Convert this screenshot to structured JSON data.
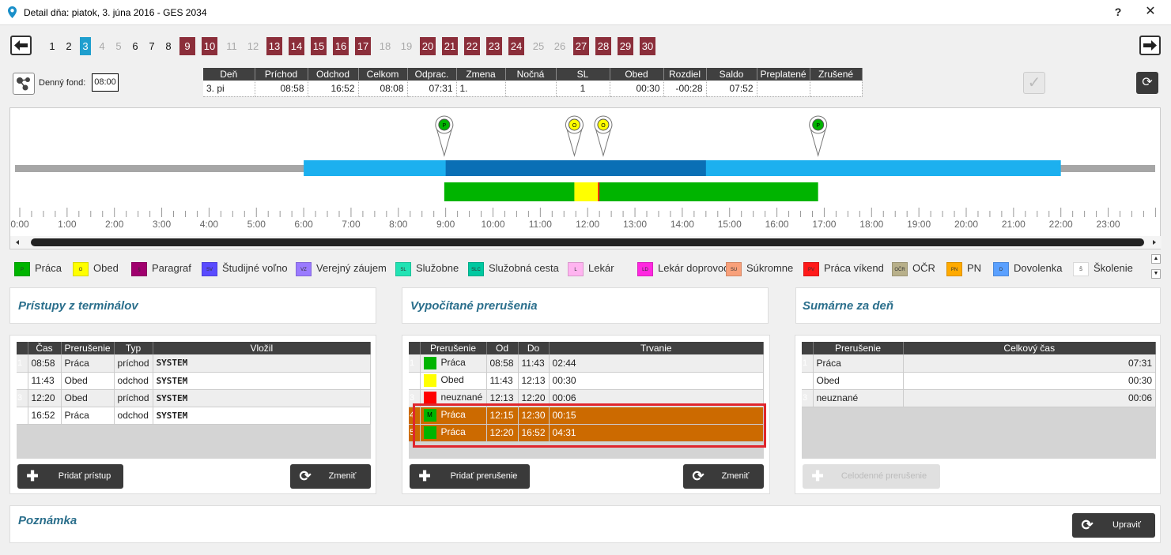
{
  "window": {
    "title": "Detail dňa: piatok, 3. júna 2016 - GES 2034",
    "help": "?",
    "close": "✕"
  },
  "days": [
    {
      "label": "1",
      "kind": "normal"
    },
    {
      "label": "2",
      "kind": "normal"
    },
    {
      "label": "3",
      "kind": "selected"
    },
    {
      "label": "4",
      "kind": "grey"
    },
    {
      "label": "5",
      "kind": "grey"
    },
    {
      "label": "6",
      "kind": "normal"
    },
    {
      "label": "7",
      "kind": "normal"
    },
    {
      "label": "8",
      "kind": "normal"
    },
    {
      "label": "9",
      "kind": "red"
    },
    {
      "label": "10",
      "kind": "red"
    },
    {
      "label": "11",
      "kind": "grey"
    },
    {
      "label": "12",
      "kind": "grey"
    },
    {
      "label": "13",
      "kind": "red"
    },
    {
      "label": "14",
      "kind": "red"
    },
    {
      "label": "15",
      "kind": "red"
    },
    {
      "label": "16",
      "kind": "red"
    },
    {
      "label": "17",
      "kind": "red"
    },
    {
      "label": "18",
      "kind": "grey"
    },
    {
      "label": "19",
      "kind": "grey"
    },
    {
      "label": "20",
      "kind": "red"
    },
    {
      "label": "21",
      "kind": "red"
    },
    {
      "label": "22",
      "kind": "red"
    },
    {
      "label": "23",
      "kind": "red"
    },
    {
      "label": "24",
      "kind": "red"
    },
    {
      "label": "25",
      "kind": "grey"
    },
    {
      "label": "26",
      "kind": "grey"
    },
    {
      "label": "27",
      "kind": "red"
    },
    {
      "label": "28",
      "kind": "red"
    },
    {
      "label": "29",
      "kind": "red"
    },
    {
      "label": "30",
      "kind": "red"
    }
  ],
  "colors": {
    "red_day": "#8b2e3a",
    "selected_day": "#1f9fce",
    "prace": "#00b400",
    "obed": "#ffff00",
    "orange": "#cc6a00",
    "shift_light": "#1cb0ef",
    "shift_dark": "#0a6fb5"
  },
  "fond": {
    "label": "Denný fond:",
    "value": "08:00"
  },
  "day_summary": {
    "headers": [
      "Deň",
      "Príchod",
      "Odchod",
      "Celkom",
      "Odprac.",
      "Zmena",
      "Nočná",
      "SL",
      "Obed",
      "Rozdiel",
      "Saldo",
      "Preplatené",
      "Zrušené"
    ],
    "row": [
      "3. pi",
      "08:58",
      "16:52",
      "08:08",
      "07:31",
      "1.",
      "",
      "1",
      "00:30",
      "-00:28",
      "07:52",
      "",
      ""
    ]
  },
  "timeline": {
    "hour_labels": [
      "0:00",
      "1:00",
      "2:00",
      "3:00",
      "4:00",
      "5:00",
      "6:00",
      "7:00",
      "8:00",
      "9:00",
      "10:00",
      "11:00",
      "12:00",
      "13:00",
      "14:00",
      "15:00",
      "16:00",
      "17:00",
      "18:00",
      "19:00",
      "20:00",
      "21:00",
      "22:00",
      "23:00"
    ],
    "markers": [
      {
        "letter": "P",
        "color": "#00b400",
        "time": 8.97
      },
      {
        "letter": "O",
        "color": "#ffff00",
        "time": 11.72
      },
      {
        "letter": "O",
        "color": "#ffff00",
        "time": 12.33
      },
      {
        "letter": "P",
        "color": "#00b400",
        "time": 16.87
      }
    ],
    "shift_light": {
      "from": 6.0,
      "to": 22.0
    },
    "shift_dark": {
      "from": 9.0,
      "to": 14.5
    },
    "segments": [
      {
        "from": 8.97,
        "to": 11.72,
        "color": "#00b400"
      },
      {
        "from": 11.72,
        "to": 12.22,
        "color": "#ffff00"
      },
      {
        "from": 12.22,
        "to": 12.25,
        "color": "#ff0000"
      },
      {
        "from": 12.25,
        "to": 16.87,
        "color": "#00b400"
      }
    ]
  },
  "legend": [
    {
      "code": "P",
      "label": "Práca",
      "color": "#00b400"
    },
    {
      "code": "O",
      "label": "Obed",
      "color": "#ffff00"
    },
    {
      "code": "§",
      "label": "Paragraf",
      "color": "#a0006e"
    },
    {
      "code": "SV",
      "label": "Študijné voľno",
      "color": "#5a4bff"
    },
    {
      "code": "VZ",
      "label": "Verejný záujem",
      "color": "#9a7aff"
    },
    {
      "code": "SL",
      "label": "Služobne",
      "color": "#22e3b4"
    },
    {
      "code": "SLC",
      "label": "Služobná cesta",
      "color": "#00c8a0"
    },
    {
      "code": "L",
      "label": "Lekár",
      "color": "#ffb4f0"
    },
    {
      "code": "LD",
      "label": "Lekár doprovod",
      "color": "#ff28e0"
    },
    {
      "code": "SU",
      "label": "Súkromne",
      "color": "#f8a07a"
    },
    {
      "code": "PV",
      "label": "Práca víkend",
      "color": "#ff1a1a"
    },
    {
      "code": "OČR",
      "label": "OČR",
      "color": "#b8b08a"
    },
    {
      "code": "PN",
      "label": "PN",
      "color": "#ffaa00"
    },
    {
      "code": "D",
      "label": "Dovolenka",
      "color": "#5aa0ff"
    },
    {
      "code": "Š",
      "label": "Školenie",
      "color": "#ffffff"
    }
  ],
  "panels": {
    "terminals": {
      "title": "Prístupy z terminálov",
      "headers": [
        "Čas",
        "Prerušenie",
        "Typ",
        "Vložil"
      ],
      "rows": [
        {
          "n": "1",
          "cas": "08:58",
          "prer": "Práca",
          "typ": "príchod",
          "vlozil": "SYSTEM"
        },
        {
          "n": "2",
          "cas": "11:43",
          "prer": "Obed",
          "typ": "odchod",
          "vlozil": "SYSTEM"
        },
        {
          "n": "3",
          "cas": "12:20",
          "prer": "Obed",
          "typ": "príchod",
          "vlozil": "SYSTEM"
        },
        {
          "n": "4",
          "cas": "16:52",
          "prer": "Práca",
          "typ": "odchod",
          "vlozil": "SYSTEM"
        }
      ],
      "add_label": "Pridať prístup",
      "change_label": "Zmeniť"
    },
    "computed": {
      "title": "Vypočítané prerušenia",
      "headers": [
        "Prerušenie",
        "Od",
        "Do",
        "Trvanie"
      ],
      "rows": [
        {
          "n": "1",
          "code": "",
          "color": "#00b400",
          "prer": "Práca",
          "od": "08:58",
          "do": "11:43",
          "trv": "02:44",
          "style": "alt"
        },
        {
          "n": "2",
          "code": "",
          "color": "#ffff00",
          "prer": "Obed",
          "od": "11:43",
          "do": "12:13",
          "trv": "00:30",
          "style": "wh"
        },
        {
          "n": "3",
          "code": "",
          "color": "#ff0000",
          "prer": "neuznané",
          "od": "12:13",
          "do": "12:20",
          "trv": "00:06",
          "style": "alt"
        },
        {
          "n": "4",
          "code": "M",
          "color": "#00b400",
          "prer": "Práca",
          "od": "12:15",
          "do": "12:30",
          "trv": "00:15",
          "style": "orange"
        },
        {
          "n": "5",
          "code": "",
          "color": "#00b400",
          "prer": "Práca",
          "od": "12:20",
          "do": "16:52",
          "trv": "04:31",
          "style": "orange"
        }
      ],
      "add_label": "Pridať prerušenie",
      "change_label": "Zmeniť"
    },
    "summary": {
      "title": "Sumárne za deň",
      "headers": [
        "Prerušenie",
        "Celkový čas"
      ],
      "rows": [
        {
          "n": "1",
          "prer": "Práca",
          "cas": "07:31"
        },
        {
          "n": "2",
          "prer": "Obed",
          "cas": "00:30"
        },
        {
          "n": "3",
          "prer": "neuznané",
          "cas": "00:06"
        }
      ],
      "allday_label": "Celodenné prerušenie"
    }
  },
  "note": {
    "title": "Poznámka",
    "edit_label": "Upraviť"
  }
}
